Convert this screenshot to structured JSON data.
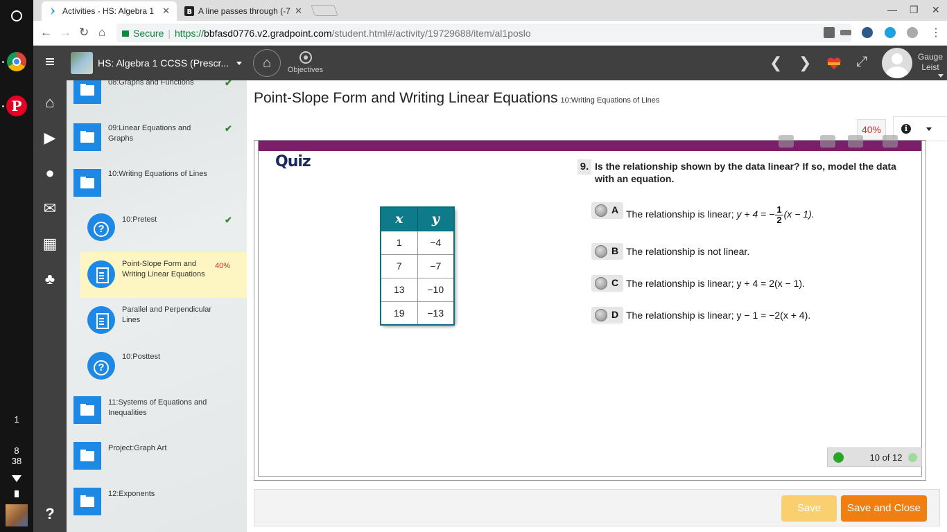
{
  "shelf": {
    "notification_count": "1",
    "clock_hour": "8",
    "clock_minute": "38"
  },
  "browser": {
    "tabs": [
      {
        "title": "Activities - HS: Algebra 1",
        "active": true
      },
      {
        "title": "A line passes through (-7",
        "active": false
      }
    ],
    "url": {
      "secure_label": "Secure",
      "scheme": "https://",
      "host": "bbfasd0776.v2.gradpoint.com",
      "path": "/student.html#/activity/19729688/item/al1poslo"
    }
  },
  "app_header": {
    "course_title": "HS: Algebra 1 CCSS (Prescr...",
    "objectives_label": "Objectives",
    "user_name_first": "Gauge",
    "user_name_last": "Leist"
  },
  "nav": {
    "items": [
      {
        "label": "08:Graphs and Functions",
        "type": "folder",
        "completed": true
      },
      {
        "label": "09:Linear Equations and Graphs",
        "type": "folder",
        "completed": true
      },
      {
        "label": "10:Writing Equations of Lines",
        "type": "folder-open",
        "completed": false
      },
      {
        "label": "10:Pretest",
        "type": "quiz",
        "completed": true
      },
      {
        "label": "Point-Slope Form and Writing Linear Equations",
        "type": "lesson",
        "progress": "40%",
        "active": true
      },
      {
        "label": "Parallel and Perpendicular Lines",
        "type": "lesson"
      },
      {
        "label": "10:Posttest",
        "type": "quiz"
      },
      {
        "label": "11:Systems of Equations and Inequalities",
        "type": "folder"
      },
      {
        "label": "Project:Graph Art",
        "type": "folder"
      },
      {
        "label": "12:Exponents",
        "type": "folder"
      }
    ]
  },
  "lesson": {
    "title": "Point-Slope Form and Writing Linear Equations",
    "unit": "10:Writing Equations of Lines",
    "progress": "40%"
  },
  "quiz": {
    "label": "Quiz",
    "table": {
      "headers": [
        "x",
        "y"
      ],
      "rows": [
        [
          "1",
          "−4"
        ],
        [
          "7",
          "−7"
        ],
        [
          "13",
          "−10"
        ],
        [
          "19",
          "−13"
        ]
      ]
    },
    "question_number": "9.",
    "question_text": "Is the relationship shown by the data linear? If so, model the data with an equation.",
    "choices": [
      {
        "letter": "A",
        "prefix": "The relationship is linear; ",
        "eq_lhs": "y + 4 = −",
        "frac_num": "1",
        "frac_den": "2",
        "eq_rhs": "(x − 1)."
      },
      {
        "letter": "B",
        "text": "The relationship is not linear."
      },
      {
        "letter": "C",
        "text": "The relationship is linear; y + 4 = 2(x − 1)."
      },
      {
        "letter": "D",
        "text": "The relationship is linear; y − 1 = −2(x + 4)."
      }
    ],
    "pager": "10 of 12"
  },
  "footer": {
    "save_label": "Save",
    "save_close_label": "Save and Close"
  }
}
